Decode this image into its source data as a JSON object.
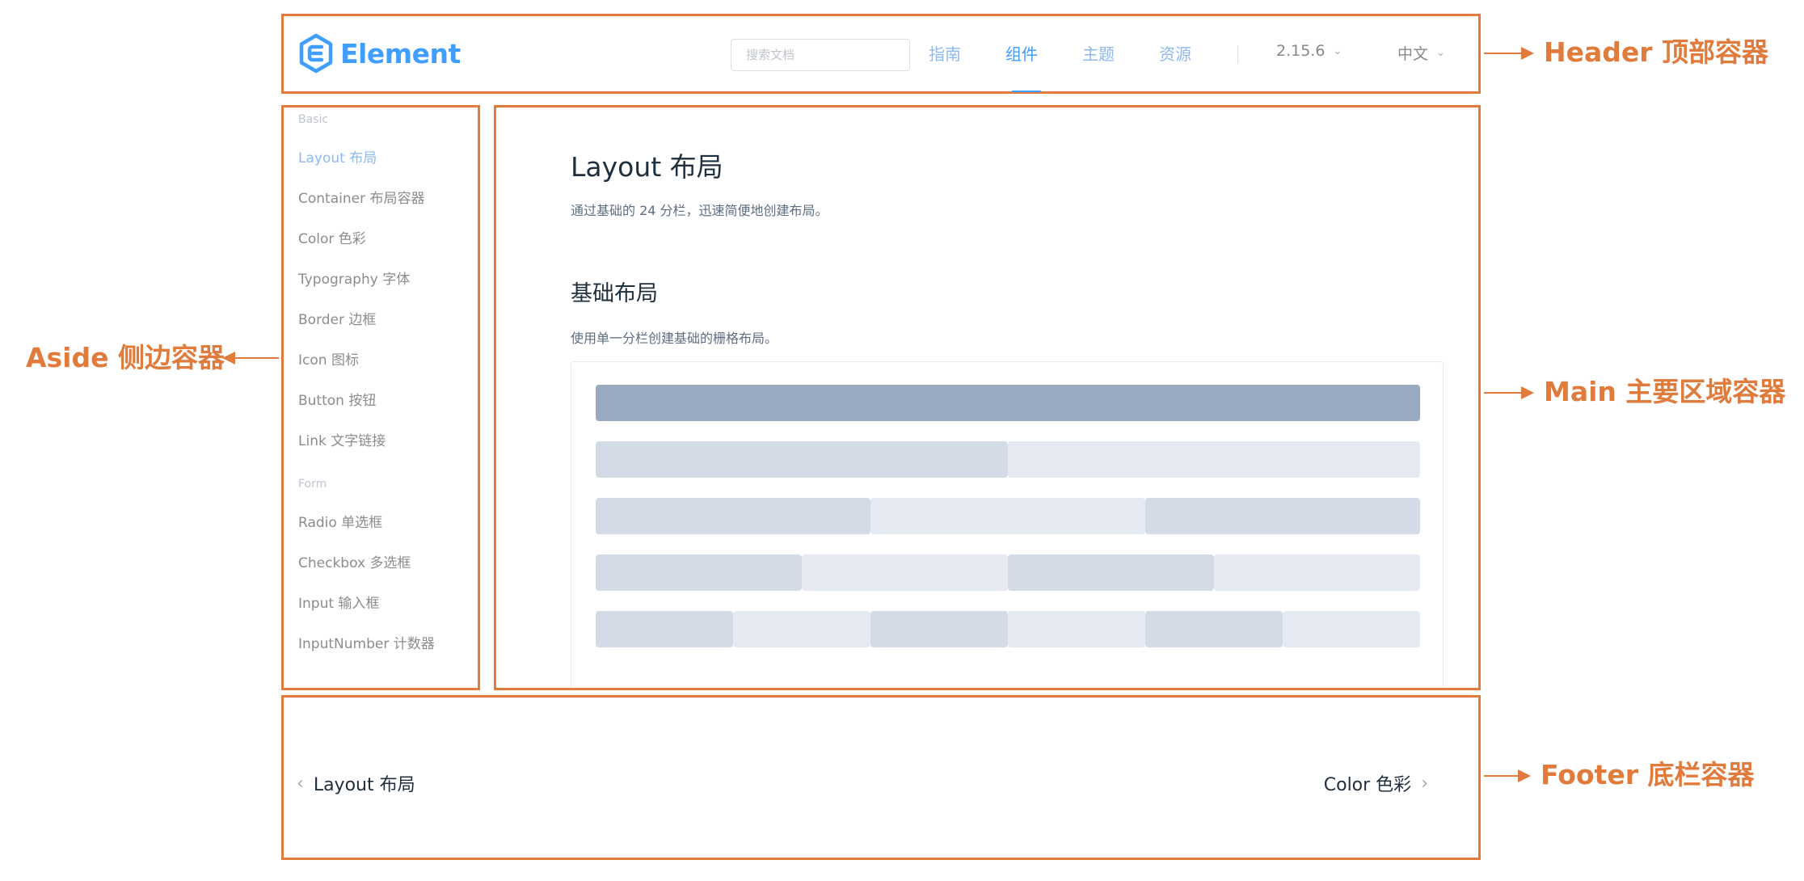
{
  "header": {
    "logo_text": "Element",
    "search_placeholder": "搜索文档",
    "nav": [
      "指南",
      "组件",
      "主题",
      "资源"
    ],
    "active_nav": "组件",
    "version": "2.15.6",
    "language": "中文"
  },
  "aside": {
    "groups": [
      {
        "title": "Basic",
        "items": [
          "Layout 布局",
          "Container 布局容器",
          "Color 色彩",
          "Typography 字体",
          "Border 边框",
          "Icon 图标",
          "Button 按钮",
          "Link 文字链接"
        ]
      },
      {
        "title": "Form",
        "items": [
          "Radio 单选框",
          "Checkbox 多选框",
          "Input 输入框",
          "InputNumber 计数器"
        ]
      }
    ],
    "active_item": "Layout 布局"
  },
  "main": {
    "title": "Layout 布局",
    "description": "通过基础的 24 分栏，迅速简便地创建布局。",
    "section_title": "基础布局",
    "section_description": "使用单一分栏创建基础的栅格布局。",
    "grid_rows": [
      [
        "dark"
      ],
      [
        "light",
        "lighter"
      ],
      [
        "light",
        "lighter",
        "light"
      ],
      [
        "light",
        "lighter",
        "light",
        "lighter"
      ],
      [
        "light",
        "lighter",
        "light",
        "lighter",
        "light",
        "lighter"
      ]
    ]
  },
  "footer": {
    "prev_label": "Layout 布局",
    "next_label": "Color 色彩"
  },
  "annotations": {
    "header": "Header 顶部容器",
    "aside": "Aside 侧边容器",
    "main": "Main 主要区域容器",
    "footer": "Footer 底栏容器"
  },
  "colors": {
    "annotation": "#e07b3c",
    "brand": "#409eff",
    "grid_dark": "#99a9bf",
    "grid_light": "#d3dce6",
    "grid_lighter": "#e5e9f2"
  }
}
